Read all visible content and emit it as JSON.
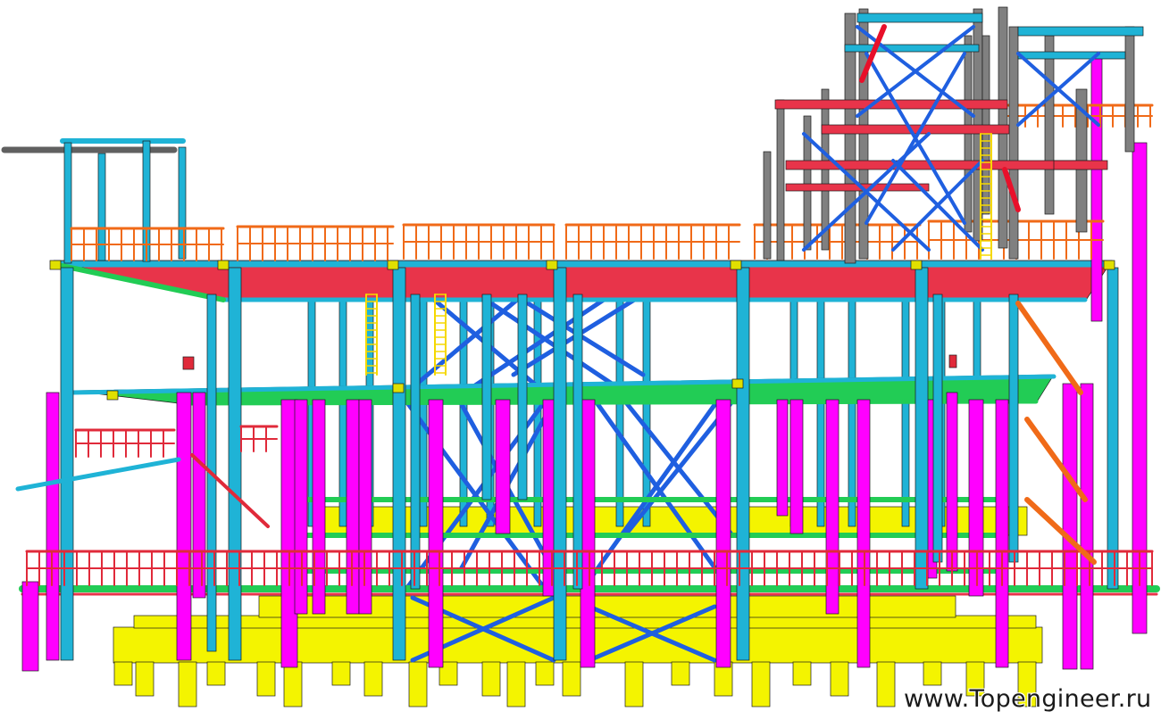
{
  "watermark": {
    "text": "www.Topengineer.ru"
  },
  "palette": {
    "foundation": "#f4f400",
    "column_primary": "#ff00ff",
    "column_steel": "#1fb3d6",
    "beam": "#22cc55",
    "bracing": "#1f5fe0",
    "railing": "#f06a18",
    "railing_lower": "#e02a3a",
    "deck": "#e8344a",
    "tower_grey": "#808080",
    "stair": "#f5d800",
    "joint": "#e0e000"
  }
}
